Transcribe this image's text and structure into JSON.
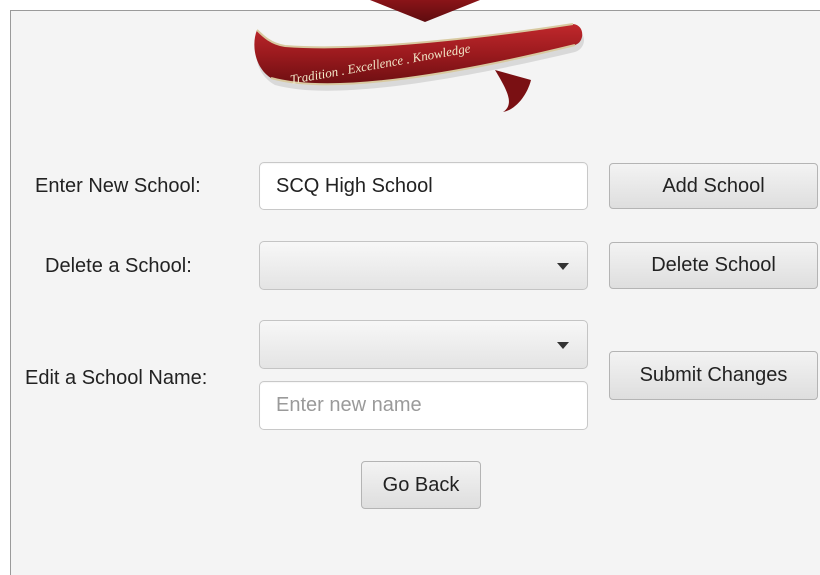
{
  "logo": {
    "motto": "Tradition . Excellence . Knowledge",
    "ribbon_color": "#9b1a1e"
  },
  "form": {
    "new_school": {
      "label": "Enter New School:",
      "value": "SCQ High School",
      "button": "Add School"
    },
    "delete_school": {
      "label": "Delete a School:",
      "button": "Delete School"
    },
    "edit_school": {
      "label": "Edit a School Name:",
      "placeholder": "Enter new name",
      "button": "Submit Changes"
    },
    "go_back": "Go Back"
  }
}
